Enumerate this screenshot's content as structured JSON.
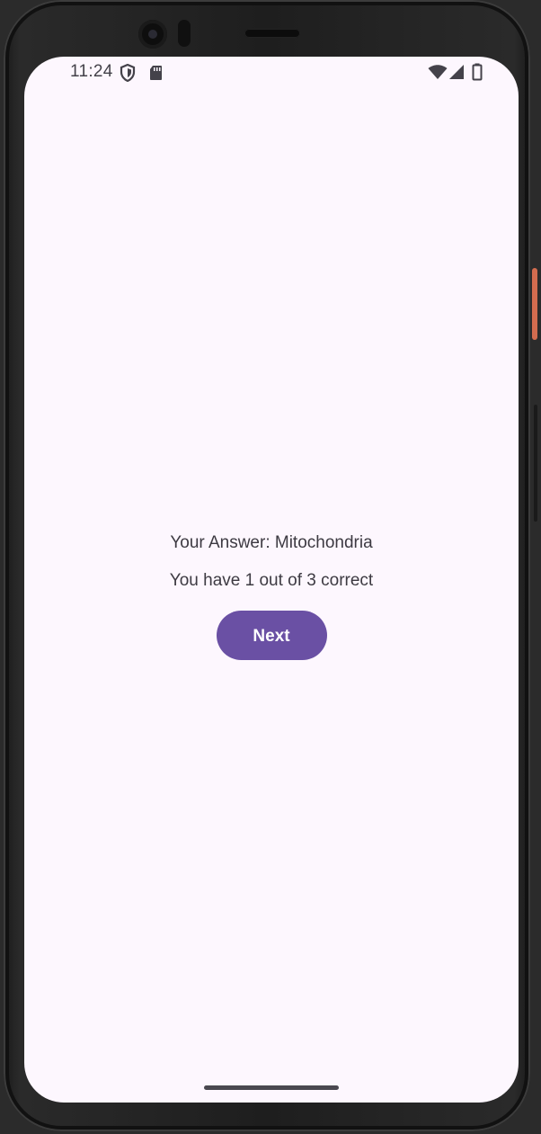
{
  "status_bar": {
    "time": "11:24",
    "left_icons": [
      "shield-icon",
      "sd-card-icon"
    ],
    "right_icons": [
      "wifi-icon",
      "signal-icon",
      "battery-icon"
    ]
  },
  "main": {
    "answer_text": "Your Answer: Mitochondria",
    "score_text": "You have 1 out of 3 correct",
    "next_label": "Next"
  },
  "colors": {
    "background": "#fdf7fe",
    "accent": "#6a50a4",
    "text": "#3d3a42"
  }
}
